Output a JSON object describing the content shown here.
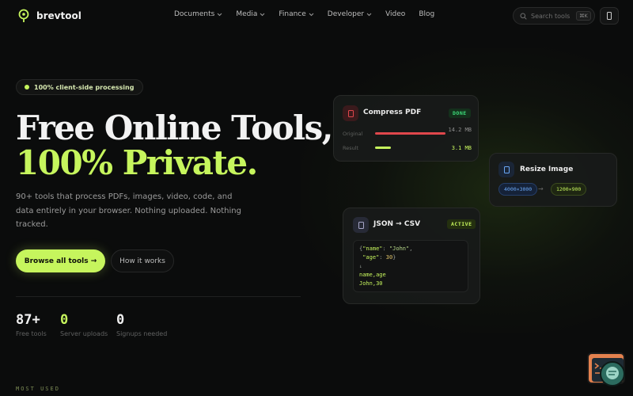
{
  "brand": {
    "name": "brevtool",
    "accent": "#c6f55d"
  },
  "nav": {
    "items": [
      {
        "label": "Documents",
        "dropdown": true
      },
      {
        "label": "Media",
        "dropdown": true
      },
      {
        "label": "Finance",
        "dropdown": true
      },
      {
        "label": "Developer",
        "dropdown": true
      },
      {
        "label": "Video",
        "dropdown": false
      },
      {
        "label": "Blog",
        "dropdown": false
      }
    ],
    "search_placeholder": "Search tools",
    "search_shortcut": "⌘K"
  },
  "hero": {
    "pill": "100% client-side processing",
    "title_line1": "Free Online Tools,",
    "title_line2": "100% Private.",
    "subtitle": "90+ tools that process PDFs, images, video, code, and data entirely in your browser. Nothing uploaded. Nothing tracked.",
    "primary_cta": "Browse all tools →",
    "secondary_cta": "How it works"
  },
  "stats": [
    {
      "value": "87+",
      "label": "Free tools",
      "accent": false
    },
    {
      "value": "0",
      "label": "Server uploads",
      "accent": true
    },
    {
      "value": "0",
      "label": "Signups needed",
      "accent": false
    }
  ],
  "section_label": "MOST USED",
  "cards": {
    "compress": {
      "title": "Compress PDF",
      "badge": "DONE",
      "original_label": "Original",
      "original_value": "14.2 MB",
      "result_label": "Result",
      "result_value": "3.1 MB",
      "original_color": "#e0474c",
      "result_color": "#c6f55d",
      "result_fraction": 0.22
    },
    "resize": {
      "title": "Resize Image",
      "from": "4000×3000",
      "arrow": "→",
      "to": "1200×900"
    },
    "json": {
      "title": "JSON → CSV",
      "badge": "ACTIVE",
      "code": {
        "l1_open": "{",
        "l1_key": "\"name\"",
        "l1_colon": ": ",
        "l1_val": "\"John\"",
        "l1_comma": ",",
        "l2_key": "\"age\"",
        "l2_colon": ": ",
        "l2_val": "30",
        "l2_close": "}",
        "l3": "↓",
        "csv_header": "name,age",
        "csv_row": "John,30"
      }
    }
  }
}
